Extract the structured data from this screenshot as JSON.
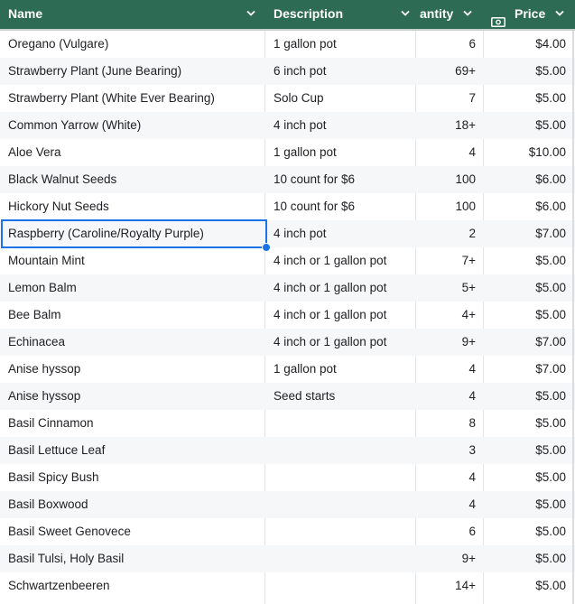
{
  "header": {
    "name": "Name",
    "description": "Description",
    "quantity": "antity",
    "price": "Price"
  },
  "rows": [
    {
      "name": "Oregano (Vulgare)",
      "description": "1 gallon pot",
      "quantity": "6",
      "price": "$4.00"
    },
    {
      "name": "Strawberry Plant (June Bearing)",
      "description": "6 inch pot",
      "quantity": "69+",
      "price": "$5.00"
    },
    {
      "name": "Strawberry Plant (White Ever Bearing)",
      "description": "Solo Cup",
      "quantity": "7",
      "price": "$5.00"
    },
    {
      "name": "Common Yarrow (White)",
      "description": "4 inch pot",
      "quantity": "18+",
      "price": "$5.00"
    },
    {
      "name": "Aloe Vera",
      "description": "1 gallon pot",
      "quantity": "4",
      "price": "$10.00"
    },
    {
      "name": "Black Walnut Seeds",
      "description": "10 count for $6",
      "quantity": "100",
      "price": "$6.00"
    },
    {
      "name": "Hickory Nut Seeds",
      "description": "10 count for $6",
      "quantity": "100",
      "price": "$6.00"
    },
    {
      "name": "Raspberry (Caroline/Royalty Purple)",
      "description": "4 inch pot",
      "quantity": "2",
      "price": "$7.00"
    },
    {
      "name": "Mountain Mint",
      "description": "4 inch or 1 gallon pot",
      "quantity": "7+",
      "price": "$5.00"
    },
    {
      "name": "Lemon Balm",
      "description": "4 inch or 1 gallon pot",
      "quantity": "5+",
      "price": "$5.00"
    },
    {
      "name": "Bee Balm",
      "description": "4 inch or 1 gallon pot",
      "quantity": "4+",
      "price": "$5.00"
    },
    {
      "name": "Echinacea",
      "description": "4 inch or 1 gallon pot",
      "quantity": "9+",
      "price": "$7.00"
    },
    {
      "name": "Anise hyssop",
      "description": "1 gallon pot",
      "quantity": "4",
      "price": "$7.00"
    },
    {
      "name": "Anise hyssop",
      "description": "Seed starts",
      "quantity": "4",
      "price": "$5.00"
    },
    {
      "name": "Basil Cinnamon",
      "description": "",
      "quantity": "8",
      "price": "$5.00"
    },
    {
      "name": "Basil Lettuce Leaf",
      "description": "",
      "quantity": "3",
      "price": "$5.00"
    },
    {
      "name": "Basil Spicy Bush",
      "description": "",
      "quantity": "4",
      "price": "$5.00"
    },
    {
      "name": "Basil Boxwood",
      "description": "",
      "quantity": "4",
      "price": "$5.00"
    },
    {
      "name": "Basil Sweet Genovece",
      "description": "",
      "quantity": "6",
      "price": "$5.00"
    },
    {
      "name": "Basil Tulsi, Holy Basil",
      "description": "",
      "quantity": "9+",
      "price": "$5.00"
    },
    {
      "name": "Schwartzenbeeren",
      "description": "",
      "quantity": "14+",
      "price": "$5.00"
    }
  ],
  "colors": {
    "header_bg": "#2e6b54",
    "header_text": "#ffffff",
    "selection": "#1a73e8",
    "stripe": "#f5f7f8"
  },
  "icons": {
    "column_menu": "chevron-down-icon",
    "price_column": "money-icon"
  }
}
